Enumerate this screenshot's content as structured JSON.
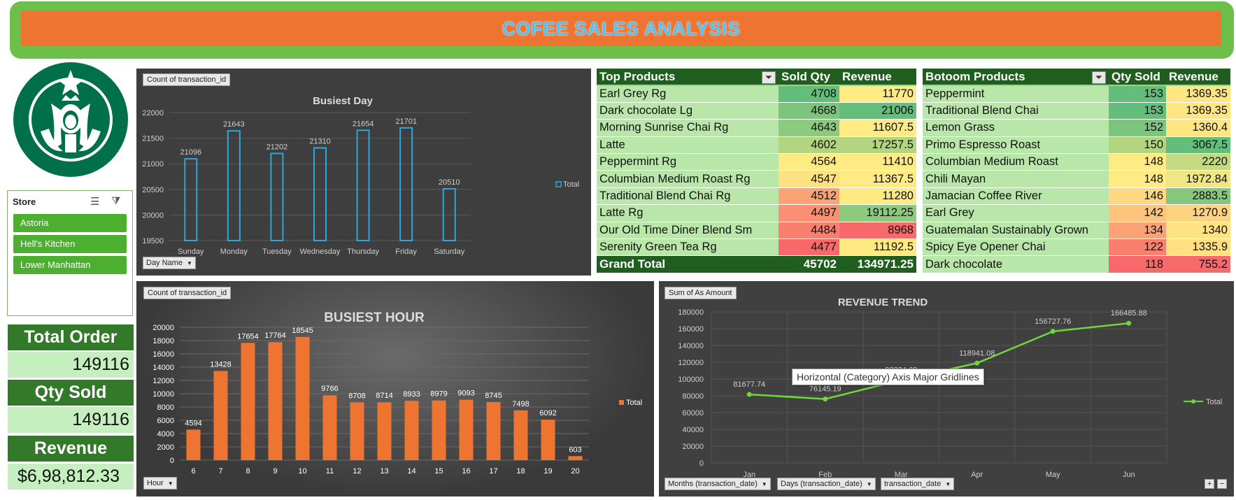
{
  "header": {
    "title": "COFEE SALES ANALYSIS"
  },
  "logo": {
    "name": "starbucks-logo"
  },
  "slicer": {
    "title": "Store",
    "items": [
      {
        "label": "Astoria"
      },
      {
        "label": "Hell's Kitchen"
      },
      {
        "label": "Lower Manhattan"
      }
    ]
  },
  "kpis": {
    "total_order_label": "Total Order",
    "total_order_value": "149116",
    "qty_sold_label": "Qty Sold",
    "qty_sold_value": "149116",
    "revenue_label": "Revenue",
    "revenue_value": "$6,98,812.33"
  },
  "top_products": {
    "headers": [
      "Top Products",
      "Sold Qty",
      "Revenue"
    ],
    "rows": [
      {
        "name": "Earl Grey Rg",
        "qty": "4708",
        "revenue": "11770",
        "qty_color": "#63be7b",
        "rev_color": "#ffeb84"
      },
      {
        "name": "Dark chocolate Lg",
        "qty": "4668",
        "revenue": "21006",
        "qty_color": "#7cc57d",
        "rev_color": "#63be7b"
      },
      {
        "name": "Morning Sunrise Chai Rg",
        "qty": "4643",
        "revenue": "11607.5",
        "qty_color": "#8ccb7e",
        "rev_color": "#ffea84"
      },
      {
        "name": "Latte",
        "qty": "4602",
        "revenue": "17257.5",
        "qty_color": "#b3d580",
        "rev_color": "#b3d580"
      },
      {
        "name": "Peppermint Rg",
        "qty": "4564",
        "revenue": "11410",
        "qty_color": "#ffeb84",
        "rev_color": "#ffea84"
      },
      {
        "name": "Columbian Medium Roast Rg",
        "qty": "4547",
        "revenue": "11367.5",
        "qty_color": "#fee282",
        "rev_color": "#ffea84"
      },
      {
        "name": "Traditional Blend Chai Rg",
        "qty": "4512",
        "revenue": "11280",
        "qty_color": "#fba276",
        "rev_color": "#fee983"
      },
      {
        "name": "Latte Rg",
        "qty": "4497",
        "revenue": "19112.25",
        "qty_color": "#fa9073",
        "rev_color": "#8ccb7e"
      },
      {
        "name": "Our Old Time Diner Blend Sm",
        "qty": "4484",
        "revenue": "8968",
        "qty_color": "#f97f6f",
        "rev_color": "#f8696b"
      },
      {
        "name": "Serenity Green Tea Rg",
        "qty": "4477",
        "revenue": "11192.5",
        "qty_color": "#f8696b",
        "rev_color": "#fee983"
      }
    ],
    "total_label": "Grand Total",
    "total_qty": "45702",
    "total_revenue": "134971.25"
  },
  "bottom_products": {
    "headers": [
      "Botoom Products",
      "Qty Sold",
      "Revenue"
    ],
    "rows": [
      {
        "name": "Peppermint",
        "qty": "153",
        "revenue": "1369.35",
        "qty_color": "#63be7b",
        "rev_color": "#ffe683"
      },
      {
        "name": "Traditional Blend Chai",
        "qty": "153",
        "revenue": "1369.35",
        "qty_color": "#63be7b",
        "rev_color": "#ffe683"
      },
      {
        "name": "Lemon Grass",
        "qty": "152",
        "revenue": "1360.4",
        "qty_color": "#7cc57d",
        "rev_color": "#ffe683"
      },
      {
        "name": "Primo Espresso Roast",
        "qty": "150",
        "revenue": "3067.5",
        "qty_color": "#b3d580",
        "rev_color": "#63be7b"
      },
      {
        "name": "Columbian Medium Roast",
        "qty": "148",
        "revenue": "2220",
        "qty_color": "#ffeb84",
        "rev_color": "#c4d981"
      },
      {
        "name": "Chili Mayan",
        "qty": "148",
        "revenue": "1972.84",
        "qty_color": "#ffeb84",
        "rev_color": "#f0e784"
      },
      {
        "name": "Jamacian Coffee River",
        "qty": "146",
        "revenue": "2883.5",
        "qty_color": "#fed880",
        "rev_color": "#84c77d"
      },
      {
        "name": "Earl Grey",
        "qty": "142",
        "revenue": "1270.9",
        "qty_color": "#fdc47c",
        "rev_color": "#fed380"
      },
      {
        "name": "Guatemalan Sustainably Grown",
        "qty": "134",
        "revenue": "1340",
        "qty_color": "#fba276",
        "rev_color": "#ffe282"
      },
      {
        "name": "Spicy Eye Opener Chai",
        "qty": "122",
        "revenue": "1335.9",
        "qty_color": "#f97f6f",
        "rev_color": "#ffe182"
      },
      {
        "name": "Dark chocolate",
        "qty": "118",
        "revenue": "755.2",
        "qty_color": "#f8696b",
        "rev_color": "#f8696b"
      }
    ]
  },
  "busiest_day": {
    "pill": "Count of transaction_id",
    "field_button": "Day Name",
    "chart_data": {
      "type": "bar",
      "title": "Busiest Day",
      "categories": [
        "Sunday",
        "Monday",
        "Tuesday",
        "Wednesday",
        "Thursday",
        "Friday",
        "Saturday"
      ],
      "series": [
        {
          "name": "Total",
          "values": [
            21096,
            21643,
            21202,
            21310,
            21654,
            21701,
            20510
          ]
        }
      ],
      "ylim": [
        19500,
        22000
      ],
      "yticks": [
        "19500",
        "20000",
        "20500",
        "21000",
        "21500",
        "22000"
      ],
      "legend": "right",
      "color": "#29a8e0"
    }
  },
  "busiest_hour": {
    "pill": "Count of transaction_id",
    "field_button": "Hour",
    "chart_data": {
      "type": "bar",
      "title": "BUSIEST HOUR",
      "categories": [
        "6",
        "7",
        "8",
        "9",
        "10",
        "11",
        "12",
        "13",
        "14",
        "15",
        "16",
        "17",
        "18",
        "19",
        "20"
      ],
      "series": [
        {
          "name": "Total",
          "values": [
            4594,
            13428,
            17654,
            17764,
            18545,
            9766,
            8708,
            8714,
            8933,
            8979,
            9093,
            8745,
            7498,
            6092,
            603
          ]
        }
      ],
      "ylim": [
        0,
        20000
      ],
      "yticks": [
        "0",
        "2000",
        "4000",
        "6000",
        "8000",
        "10000",
        "12000",
        "14000",
        "16000",
        "18000",
        "20000"
      ],
      "legend": "right",
      "color": "#ee7431"
    }
  },
  "revenue_trend": {
    "pill": "Sum of As Amount",
    "field_buttons": [
      "Months (transaction_date)",
      "Days (transaction_date)",
      "transaction_date"
    ],
    "tooltip": "Horizontal (Category) Axis Major Gridlines",
    "chart_data": {
      "type": "line",
      "title": "REVENUE TREND",
      "categories": [
        "Jan",
        "Feb",
        "Mar",
        "Apr",
        "May",
        "Jun"
      ],
      "series": [
        {
          "name": "Total",
          "values": [
            81677.74,
            76145.19,
            98834.68,
            118941.08,
            156727.76,
            166485.88
          ]
        }
      ],
      "labels": [
        "81677.74",
        "76145.19",
        "98834.68",
        "118941.08",
        "156727.76",
        "166485.88"
      ],
      "ylim": [
        0,
        180000
      ],
      "yticks": [
        "0",
        "20000",
        "40000",
        "60000",
        "80000",
        "100000",
        "120000",
        "140000",
        "160000",
        "180000"
      ],
      "legend": "right",
      "color": "#6ed83a"
    }
  }
}
